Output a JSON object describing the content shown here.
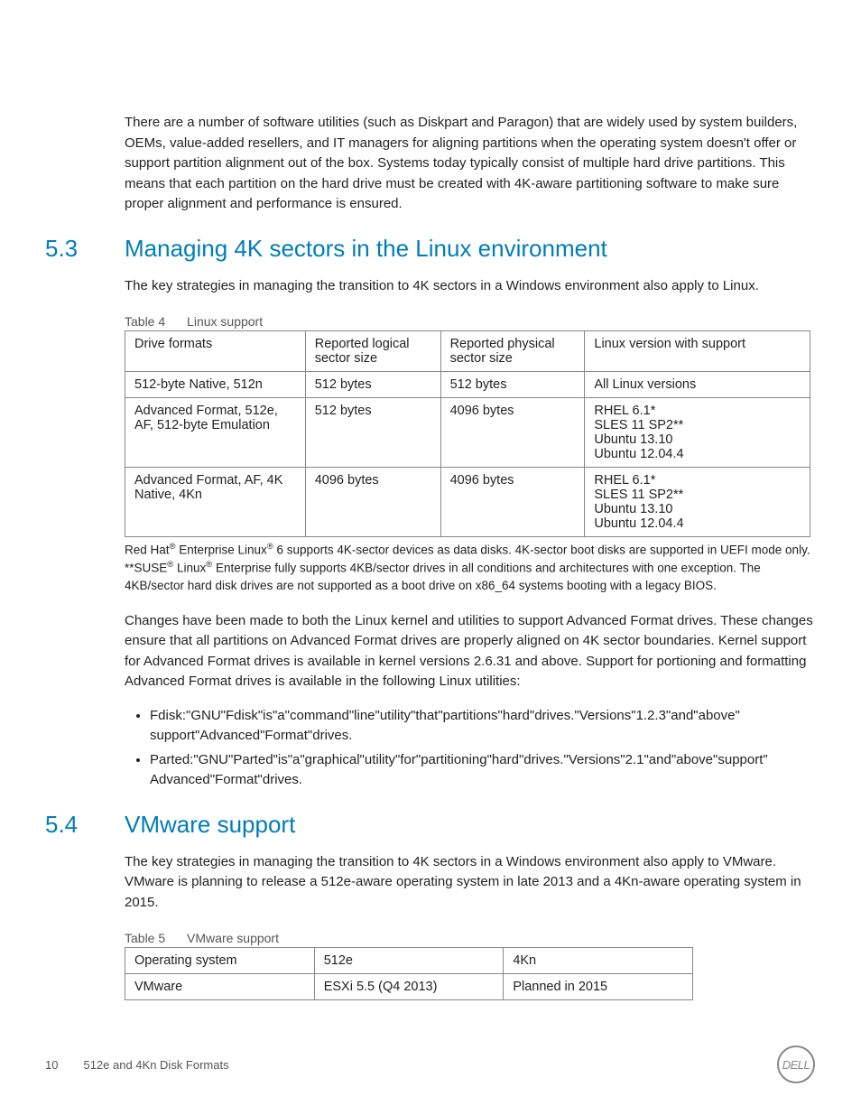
{
  "intro": "There are a number of software utilities (such as Diskpart and Paragon) that are widely used by system builders, OEMs, value-added resellers, and IT managers for aligning partitions when the operating system doesn't offer or support partition alignment out of the box. Systems today typically consist of multiple hard drive partitions. This means that each partition on the hard drive must be created with 4K-aware partitioning software to make sure proper alignment and performance is ensured.",
  "s53": {
    "num": "5.3",
    "title": "Managing 4K sectors in the Linux environment",
    "lead": "The key strategies in managing the transition to 4K sectors in a Windows environment also apply to Linux.",
    "table_label": "Table 4",
    "table_title": "Linux support",
    "headers": {
      "c1": "Drive formats",
      "c2": "Reported logical sector size",
      "c3": "Reported physical sector size",
      "c4": "Linux version with support"
    },
    "rows": [
      {
        "c1": "512-byte Native, 512n",
        "c2": "512 bytes",
        "c3": "512 bytes",
        "c4": "All Linux versions"
      },
      {
        "c1": "Advanced Format, 512e, AF, 512-byte Emulation",
        "c2": "512 bytes",
        "c3": "4096 bytes",
        "c4": "RHEL 6.1*\nSLES 11 SP2**\nUbuntu 13.10\nUbuntu 12.04.4"
      },
      {
        "c1": "Advanced Format, AF, 4K Native, 4Kn",
        "c2": "4096 bytes",
        "c3": "4096 bytes",
        "c4": "RHEL 6.1*\nSLES 11 SP2**\nUbuntu 13.10\nUbuntu 12.04.4"
      }
    ],
    "foot1a": " Red Hat",
    "foot1b": " Enterprise Linux",
    "foot1c": " 6 supports 4K-sector devices as data disks. 4K-sector boot disks are supported in UEFI mode only.",
    "foot2a": "**SUSE",
    "foot2b": " Linux",
    "foot2c": " Enterprise fully supports 4KB/sector drives in all conditions and architectures with one exception. The 4KB/sector hard disk drives are not supported as a boot drive on x86_64 systems booting with a legacy BIOS.",
    "para2": "Changes have been made to both the Linux kernel and utilities to support Advanced Format drives. These changes ensure that all partitions on Advanced Format drives are properly aligned on 4K sector boundaries. Kernel support for Advanced Format drives is available in kernel versions 2.6.31 and above. Support for portioning and formatting Advanced Format drives is available in the following Linux utilities:",
    "bullets": [
      "Fdisk:\"GNU\"Fdisk\"is\"a\"command\"line\"utility\"that\"partitions\"hard\"drives.\"Versions\"1.2.3\"and\"above\" support\"Advanced\"Format\"drives.",
      "Parted:\"GNU\"Parted\"is\"a\"graphical\"utility\"for\"partitioning\"hard\"drives.\"Versions\"2.1\"and\"above\"support\" Advanced\"Format\"drives."
    ]
  },
  "s54": {
    "num": "5.4",
    "title": "VMware support",
    "lead": "The key strategies in managing the transition to 4K sectors in a Windows environment also apply to VMware. VMware is planning to release a 512e-aware operating system in late 2013 and a 4Kn-aware operating system in 2015.",
    "table_label": "Table 5",
    "table_title": "VMware support",
    "headers": {
      "c1": "Operating system",
      "c2": "512e",
      "c3": "4Kn"
    },
    "rows": [
      {
        "c1": "VMware",
        "c2": "ESXi 5.5 (Q4 2013)",
        "c3": "Planned in 2015"
      }
    ]
  },
  "footer": {
    "page": "10",
    "doc": "512e and 4Kn Disk Formats",
    "logo_text": "DELL"
  }
}
